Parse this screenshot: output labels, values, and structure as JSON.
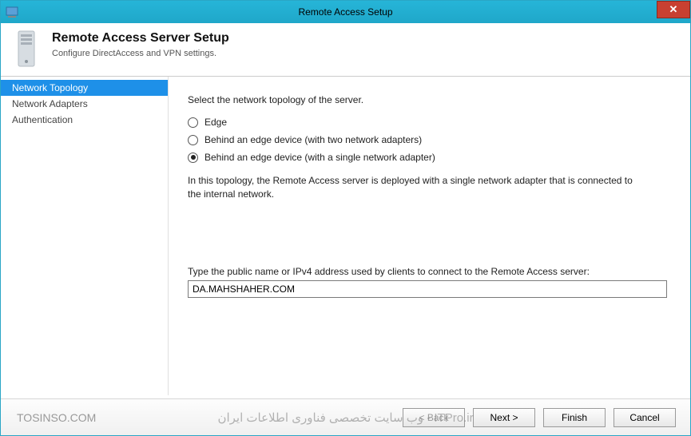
{
  "window": {
    "title": "Remote Access Setup"
  },
  "header": {
    "title": "Remote Access Server Setup",
    "subtitle": "Configure DirectAccess and VPN settings."
  },
  "sidebar": {
    "items": [
      {
        "label": "Network Topology",
        "selected": true
      },
      {
        "label": "Network Adapters",
        "selected": false
      },
      {
        "label": "Authentication",
        "selected": false
      }
    ]
  },
  "main": {
    "instruction": "Select the network topology of the server.",
    "options": [
      {
        "label": "Edge",
        "checked": false
      },
      {
        "label": "Behind an edge device (with two network adapters)",
        "checked": false
      },
      {
        "label": "Behind an edge device (with a single network adapter)",
        "checked": true
      }
    ],
    "description": "In this topology, the Remote Access server is deployed with a single network adapter that is connected to the internal network.",
    "public_name_label": "Type the public name or IPv4 address used by clients to connect to the Remote Access server:",
    "public_name_value": "DA.MAHSHAHER.COM"
  },
  "footer": {
    "watermark_left": "TOSINSO.COM",
    "watermark_center": "ITPro.ir - وب سایت تخصصی فناوری اطلاعات ایران",
    "back": "< Back",
    "next": "Next >",
    "finish": "Finish",
    "cancel": "Cancel"
  }
}
